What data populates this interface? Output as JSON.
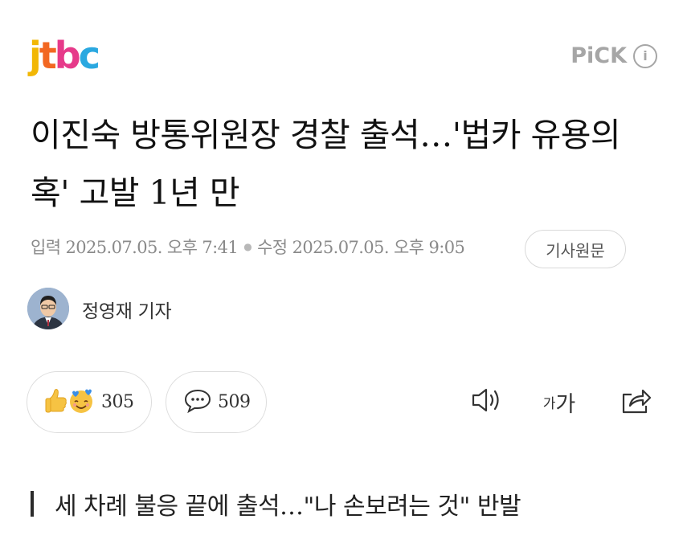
{
  "header": {
    "logo_letters": [
      "j",
      "t",
      "b",
      "c"
    ],
    "logo_colors": [
      "#f2b705",
      "#f26722",
      "#e63a8a",
      "#2aa8e0"
    ],
    "pick_label": "PiCK",
    "pick_info_icon": "i"
  },
  "article": {
    "headline": "이진숙 방통위원장 경찰 출석…'법카 유용의혹' 고발 1년 만",
    "input_date": "입력 2025.07.05. 오후 7:41",
    "modified_date": "수정 2025.07.05. 오후 9:05",
    "original_button": "기사원문",
    "reporter": "정영재 기자",
    "subheading": "세 차례 불응 끝에 출석…\"나 손보려는 것\" 반발"
  },
  "reactions": {
    "reaction_count": "305",
    "comment_count": "509"
  },
  "tools": {
    "font_small": "가",
    "font_big": "가"
  }
}
